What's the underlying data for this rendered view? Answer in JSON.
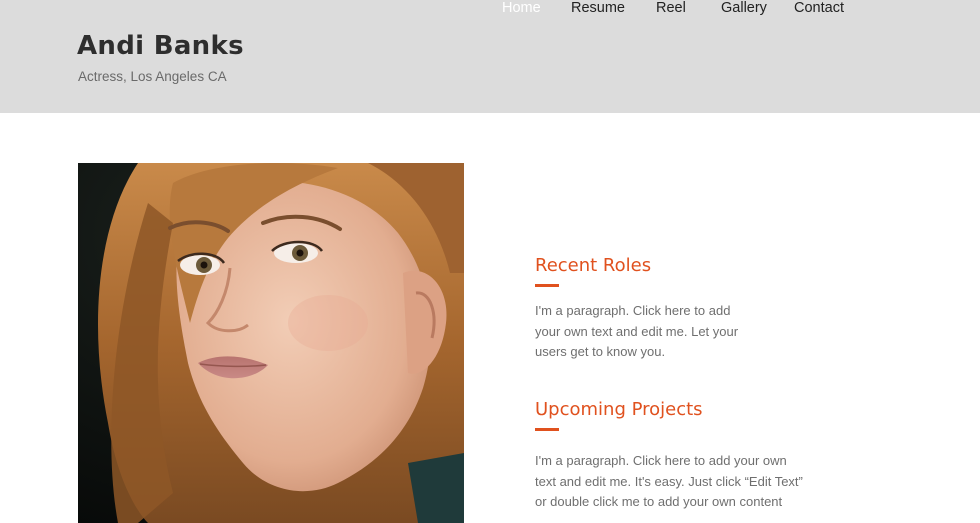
{
  "header": {
    "site_title": "Andi Banks",
    "tagline": "Actress, Los Angeles CA",
    "background": "#dcdcdc"
  },
  "nav": {
    "items": [
      {
        "label": "Home",
        "active": true
      },
      {
        "label": "Resume",
        "active": false
      },
      {
        "label": "Reel",
        "active": false
      },
      {
        "label": "Gallery",
        "active": false
      },
      {
        "label": "Contact",
        "active": false
      }
    ]
  },
  "hero": {
    "image": "portrait-photo"
  },
  "sections": [
    {
      "heading": "Recent Roles",
      "body": "I'm a paragraph. Click here to add\nyour own text and edit me. Let your\nusers get to know you."
    },
    {
      "heading": "Upcoming Projects",
      "body": "I'm a paragraph. Click here to add your own\ntext and edit me. It's easy. Just click “Edit Text”\nor double click me to add your own content"
    }
  ],
  "colors": {
    "accent": "#e0511e",
    "nav_active": "#ffffff",
    "nav_text": "#222222",
    "body_text": "#6f6f6f"
  }
}
